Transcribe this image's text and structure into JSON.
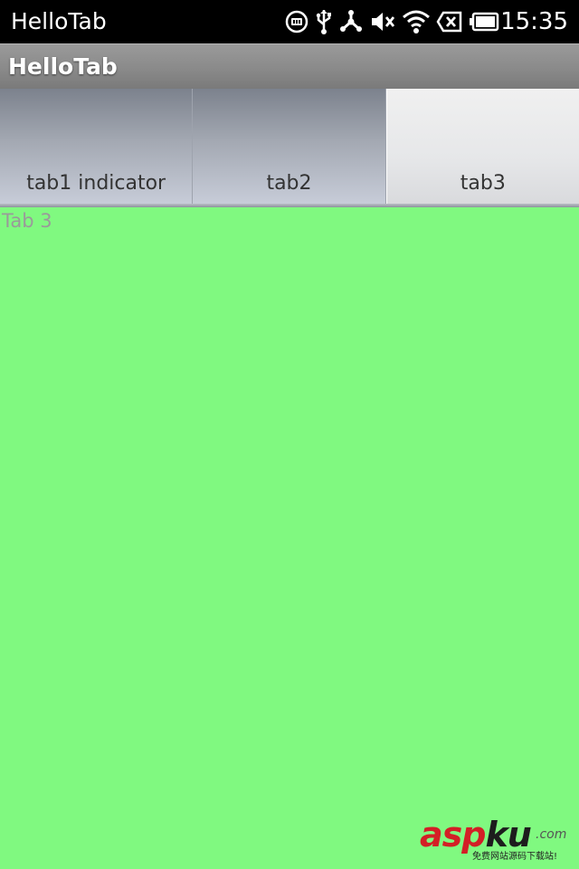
{
  "status_bar": {
    "notification_title": "HelloTab",
    "time": "15:35",
    "icons": [
      "media-icon",
      "usb-icon",
      "share-icon",
      "mute-icon",
      "wifi-icon",
      "no-sim-icon",
      "battery-icon"
    ],
    "color": "#ffffff"
  },
  "app_bar": {
    "title": "HelloTab"
  },
  "tabs": [
    {
      "label": "tab1 indicator",
      "selected": false
    },
    {
      "label": "tab2",
      "selected": false
    },
    {
      "label": "tab3",
      "selected": true
    }
  ],
  "content": {
    "text": "Tab 3",
    "background_color": "#80f980"
  },
  "watermark": {
    "brand_part1": "asp",
    "brand_part2": "ku",
    "suffix": ".com",
    "tagline": "免费网站源码下载站!"
  },
  "colors": {
    "status_bar_bg": "#000000",
    "title_bar_bg": "#8a8a8a",
    "selected_tab_bg": "#e6e7e9",
    "unselected_tab_bg": "#a3a8b2"
  }
}
